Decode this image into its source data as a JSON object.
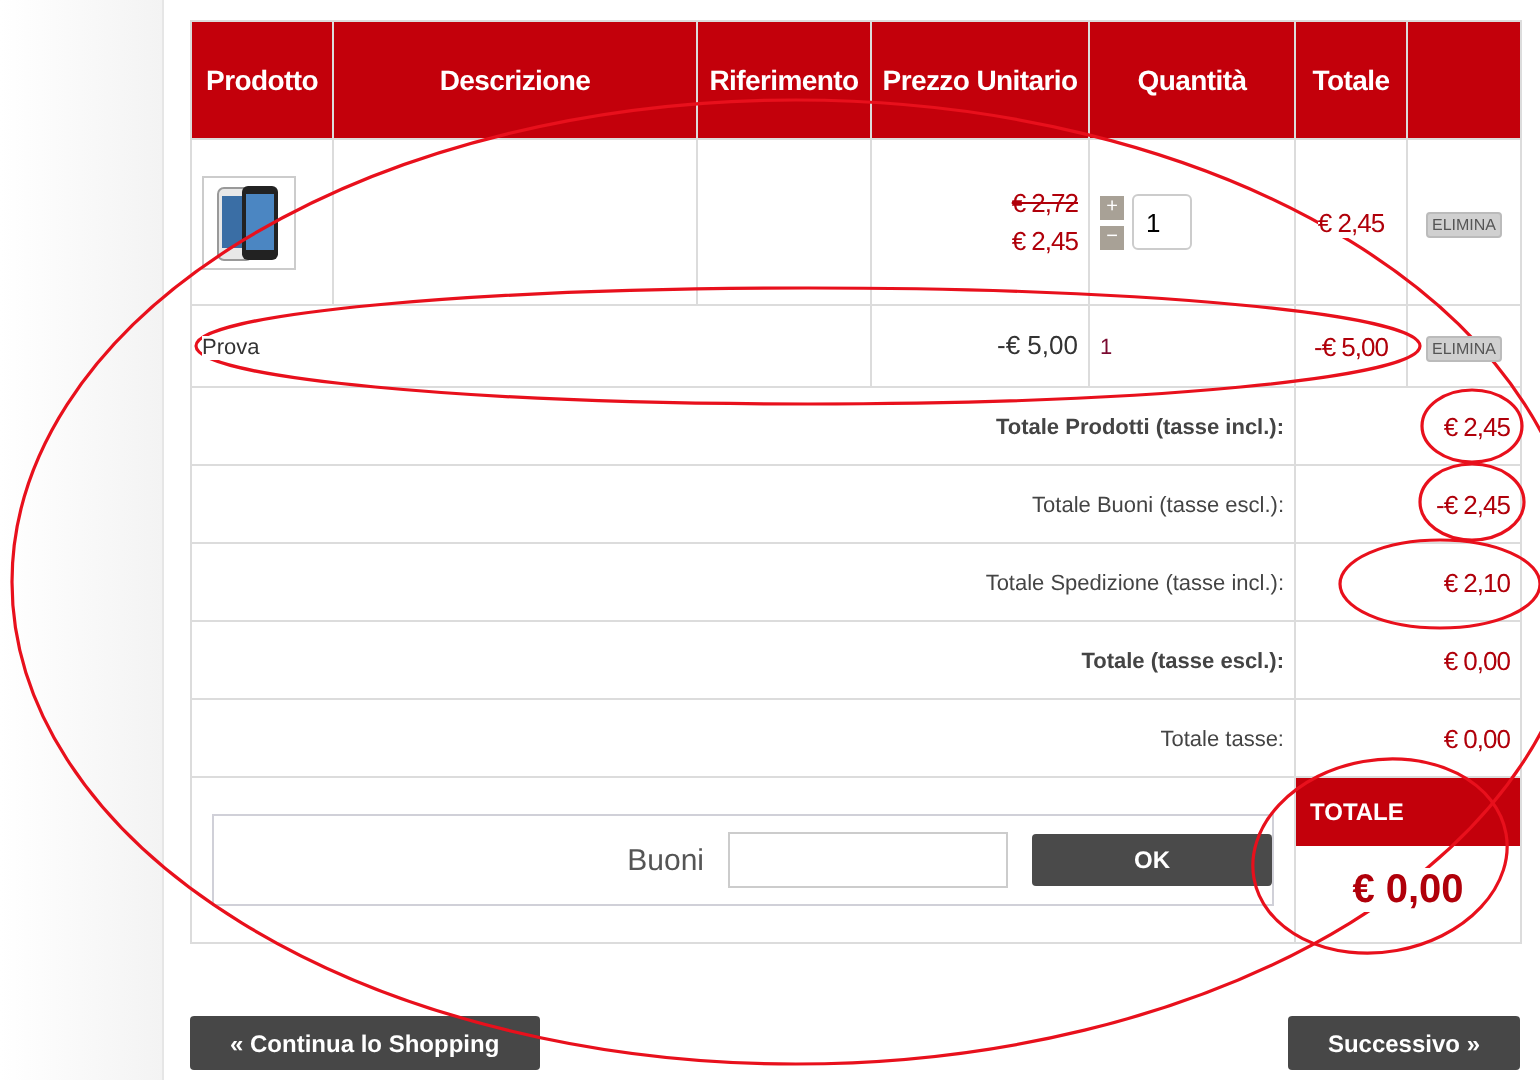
{
  "cart": {
    "columns": [
      "Prodotto",
      "Descrizione",
      "Riferimento",
      "Prezzo Unitario",
      "Quantità",
      "Totale"
    ],
    "rows": [
      {
        "kind": "product",
        "old_price": "€ 2,72",
        "price": "€ 2,45",
        "quantity": "1",
        "plus": "+",
        "minus": "−",
        "total": "€ 2,45",
        "delete": "ELIMINA"
      },
      {
        "kind": "voucher",
        "name": "Prova",
        "price": "-€ 5,00",
        "quantity": "1",
        "total": "-€ 5,00",
        "delete": "ELIMINA"
      }
    ],
    "summary": [
      {
        "label": "Totale Prodotti (tasse incl.):",
        "value": "€ 2,45",
        "bold": true
      },
      {
        "label": "Totale Buoni (tasse escl.):",
        "value": "-€ 2,45",
        "bold": false
      },
      {
        "label": "Totale Spedizione (tasse incl.):",
        "value": "€ 2,10",
        "bold": false
      },
      {
        "label": "Totale (tasse escl.):",
        "value": "€ 0,00",
        "bold": true
      },
      {
        "label": "Totale tasse:",
        "value": "€ 0,00",
        "bold": false
      }
    ],
    "voucher": {
      "label": "Buoni",
      "button": "OK"
    },
    "total": {
      "title": "TOTALE",
      "value": "€ 0,00"
    }
  },
  "navigation": {
    "back": "« Continua lo Shopping",
    "next": "Successivo »"
  }
}
